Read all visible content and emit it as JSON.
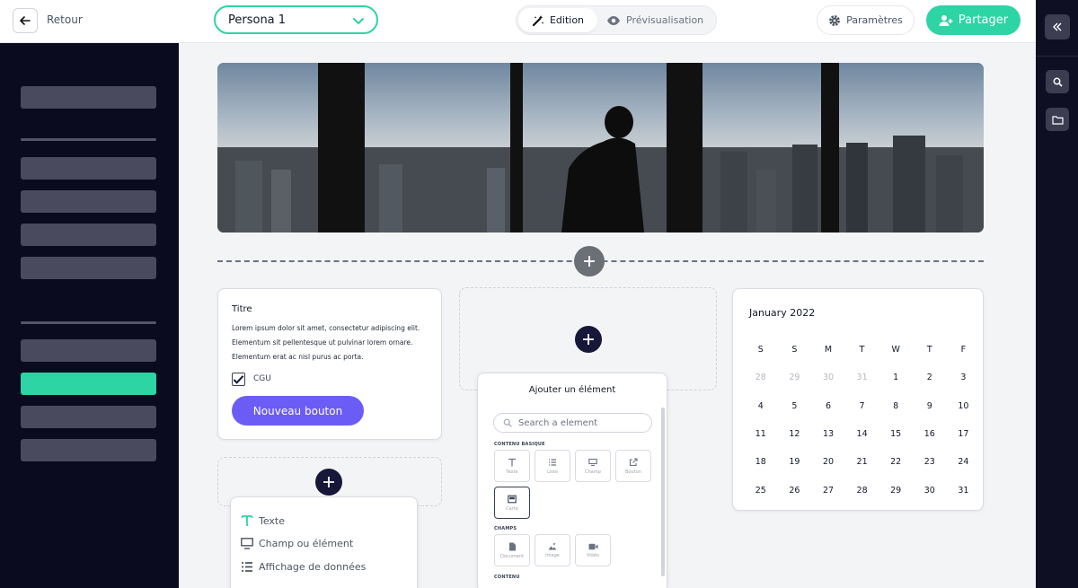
{
  "header": {
    "back_label": "Retour",
    "persona": "Persona 1",
    "mode_edit": "Edition",
    "mode_preview": "Prévisualisation",
    "settings": "Paramètres",
    "share": "Partager"
  },
  "sidebar": {
    "active_index": 5
  },
  "text_card": {
    "title": "Titre",
    "body": "Lorem ipsum dolor sit amet, consectetur adipiscing elit. Elementum sit pellentesque ut pulvinar lorem ornare. Elementum erat ac nisl purus ac porta.",
    "checkbox_label": "CGU",
    "checked": true,
    "button_label": "Nouveau bouton"
  },
  "calendar": {
    "month_label": "January  2022",
    "weekdays": [
      "S",
      "S",
      "M",
      "T",
      "W",
      "T",
      "F"
    ],
    "days": [
      [
        "28",
        "29",
        "30",
        "31",
        "1",
        "2",
        "3"
      ],
      [
        "4",
        "5",
        "6",
        "7",
        "8",
        "9",
        "10"
      ],
      [
        "11",
        "12",
        "13",
        "14",
        "15",
        "16",
        "17"
      ],
      [
        "18",
        "19",
        "20",
        "21",
        "22",
        "23",
        "24"
      ],
      [
        "25",
        "26",
        "27",
        "28",
        "29",
        "30",
        "31"
      ]
    ],
    "muted_days_first_row": 4
  },
  "add_panel": {
    "title": "Ajouter un élément",
    "search_placeholder": "Search a element",
    "section_basic": "CONTENU BASIQUE",
    "section_fields": "CHAMPS",
    "section_content": "CONTENU",
    "tiles_basic": [
      "Texte",
      "Liste",
      "Champ",
      "Bouton",
      "Carte"
    ],
    "tiles_fields": [
      "Document",
      "Image",
      "Vidéo"
    ]
  },
  "insert_menu": {
    "items": [
      "Texte",
      "Champ ou élément",
      "Affichage de données"
    ]
  },
  "colors": {
    "accent": "#2dd4a4",
    "primary_button": "#6b5cf6",
    "sidebar_bg": "#0b0b1f"
  }
}
